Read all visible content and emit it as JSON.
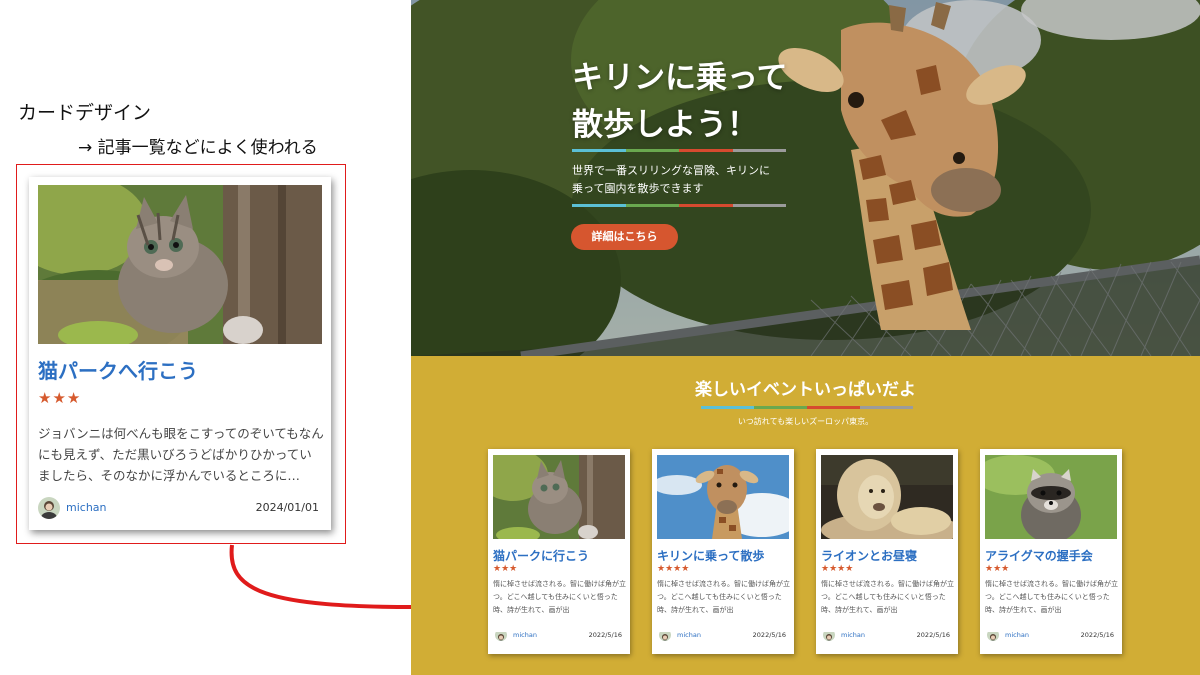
{
  "annotation": {
    "title": "カードデザイン",
    "subtitle": "→ 記事一覧などによく使われる"
  },
  "big_card": {
    "image": "kitten-photo",
    "title": "猫パークへ行こう",
    "stars": "★★★",
    "text": "ジョバンニは何べんも眼をこすってのぞいてもなんにも見えず、ただ黒いびろうどばかりひかっていましたら、そのなかに浮かんでいるところに…",
    "author": "michan",
    "date": "2024/01/01"
  },
  "hero": {
    "image": "giraffe-photo",
    "title_line1": "キリンに乗って",
    "title_line2": "散歩しよう！",
    "desc_line1": "世界で一番スリリングな冒険、キリンに",
    "desc_line2": "乗って園内を散歩できます",
    "button": "詳細はこちら"
  },
  "event": {
    "title": "楽しいイベントいっぱいだよ",
    "subtitle": "いつ訪れても楽しいズーロッパ東京。"
  },
  "cards": [
    {
      "image": "kitten-photo",
      "title": "猫パークに行こう",
      "stars": "★★★",
      "text": "惰に棹させば流される。智に働けば角が立つ。どこへ越しても住みにくいと悟った時、詩が生れて、画が出",
      "author": "michan",
      "date": "2022/5/16"
    },
    {
      "image": "giraffe-photo",
      "title": "キリンに乗って散歩",
      "stars": "★★★★",
      "text": "惰に棹させば流される。智に働けば角が立つ。どこへ越しても住みにくいと悟った時、詩が生れて、画が出",
      "author": "michan",
      "date": "2022/5/16"
    },
    {
      "image": "lion-photo",
      "title": "ライオンとお昼寝",
      "stars": "★★★★",
      "text": "惰に棹させば流される。智に働けば角が立つ。どこへ越しても住みにくいと悟った時、詩が生れて、画が出",
      "author": "michan",
      "date": "2022/5/16"
    },
    {
      "image": "raccoon-photo",
      "title": "アライグマの握手会",
      "stars": "★★★",
      "text": "惰に棹させば流される。智に働けば角が立つ。どこへ越しても住みにくいと悟った時、詩が生れて、画が出",
      "author": "michan",
      "date": "2022/5/16"
    }
  ],
  "colors": {
    "card_title": "#2c6fc2",
    "stars": "#d65a2e",
    "button": "#d6562f",
    "event_bg": "#d1ad35",
    "highlight": "#e01b1b",
    "stripe": [
      "#5bc0d6",
      "#6aa84f",
      "#d64a2f",
      "#9b9b9b"
    ]
  }
}
